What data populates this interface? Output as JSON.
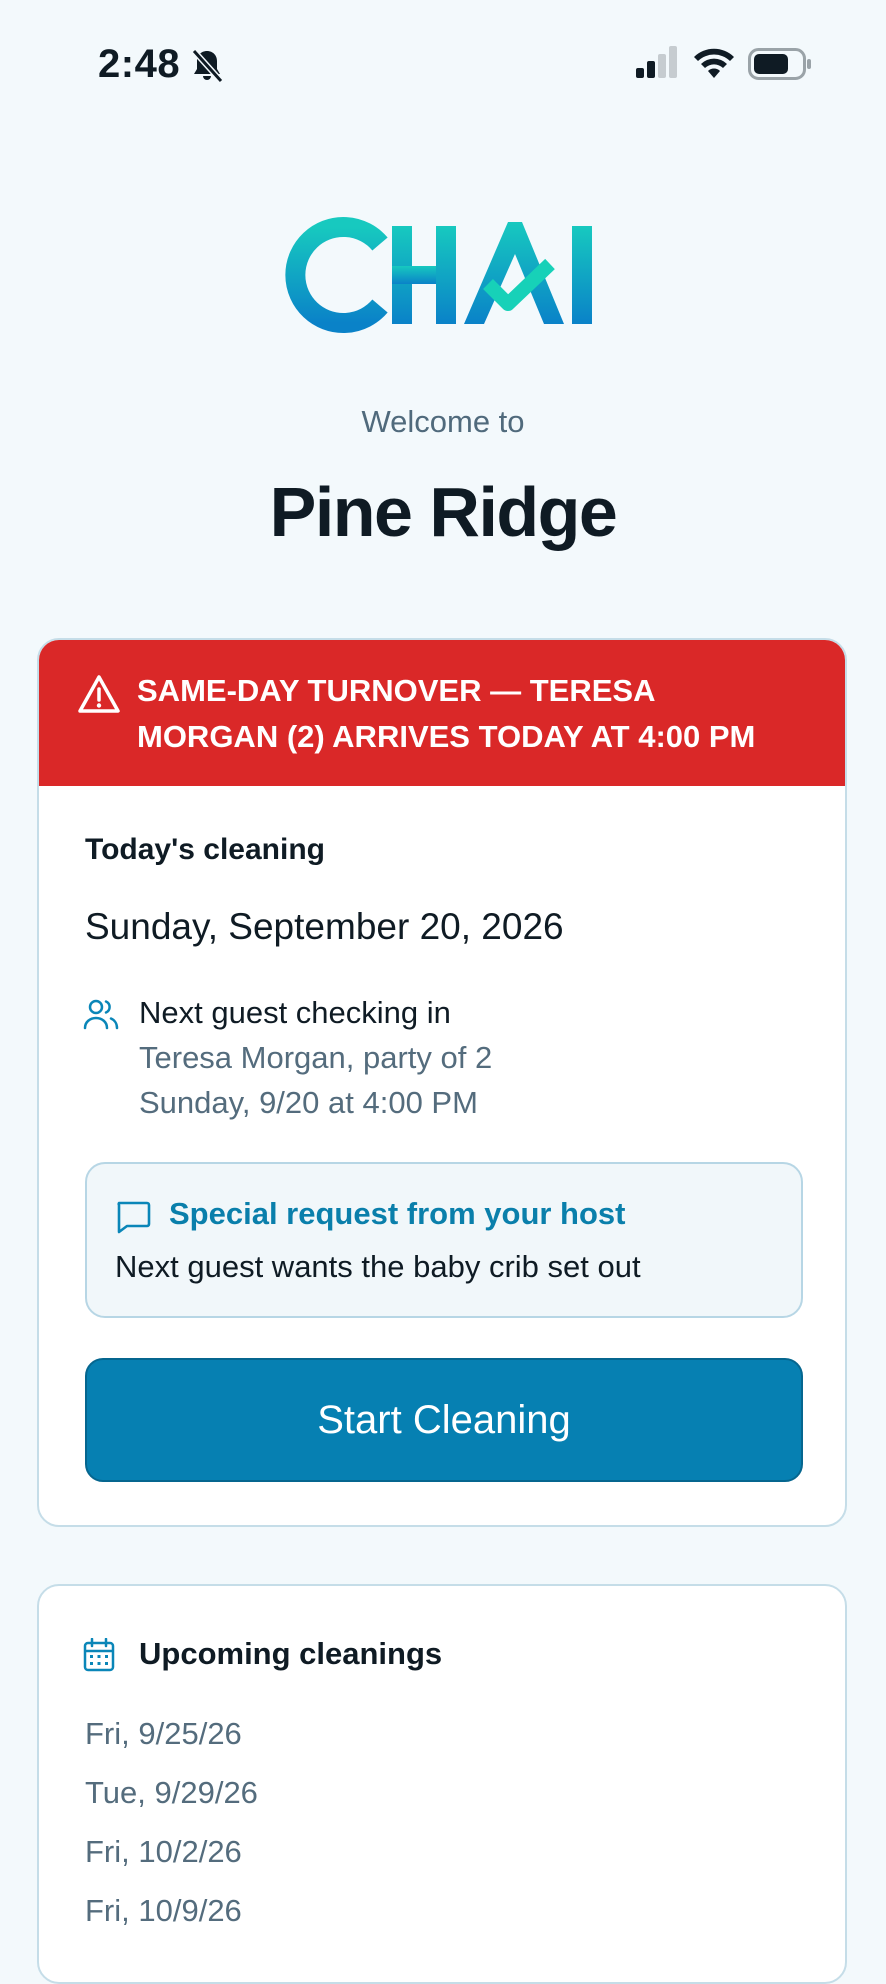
{
  "status_bar": {
    "time": "2:48",
    "icons": [
      "bell-slash-icon",
      "cellular-signal-icon",
      "wifi-icon",
      "battery-icon"
    ]
  },
  "brand": {
    "logo_text": "CHAI",
    "colors": {
      "teal": "#16c6c0",
      "blue": "#0a86c6"
    }
  },
  "header": {
    "welcome": "Welcome to",
    "property_name": "Pine Ridge"
  },
  "alert": {
    "icon": "warning-triangle-icon",
    "line1": "SAME-DAY TURNOVER — TERESA",
    "line2": "MORGAN (2) ARRIVES TODAY AT 4:00 PM",
    "color": "#da2828"
  },
  "today": {
    "label": "Today's cleaning",
    "date": "Sunday, September 20, 2026",
    "guest": {
      "icon": "users-icon",
      "title": "Next guest checking in",
      "line1": "Teresa Morgan, party of 2",
      "line2": "Sunday, 9/20 at 4:00 PM"
    },
    "request": {
      "icon": "message-square-icon",
      "title": "Special request from your host",
      "body": "Next guest wants the baby crib set out"
    },
    "start_button": "Start Cleaning"
  },
  "upcoming": {
    "icon": "calendar-icon",
    "title": "Upcoming cleanings",
    "dates": [
      "Fri, 9/25/26",
      "Tue, 9/29/26",
      "Fri, 10/2/26",
      "Fri, 10/9/26"
    ]
  }
}
